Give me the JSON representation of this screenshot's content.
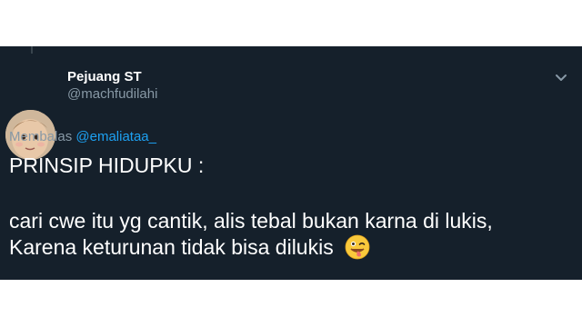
{
  "tweet": {
    "author": {
      "display_name": "Pejuang ST",
      "handle": "@machfudilahi"
    },
    "reply_prefix": "Membalas",
    "reply_to": "@emaliataa_",
    "lines": [
      "PRINSIP HIDUPKU :",
      "cari cwe itu yg cantik, alis tebal bukan karna di lukis,",
      "Karena keturunan tidak bisa dilukis"
    ],
    "emoji": "winking-face-with-tongue",
    "menu_icon": "chevron-down-icon",
    "colors": {
      "background": "#15202b",
      "text": "#ffffff",
      "muted": "#8899a6",
      "mention": "#1da1f2"
    }
  }
}
